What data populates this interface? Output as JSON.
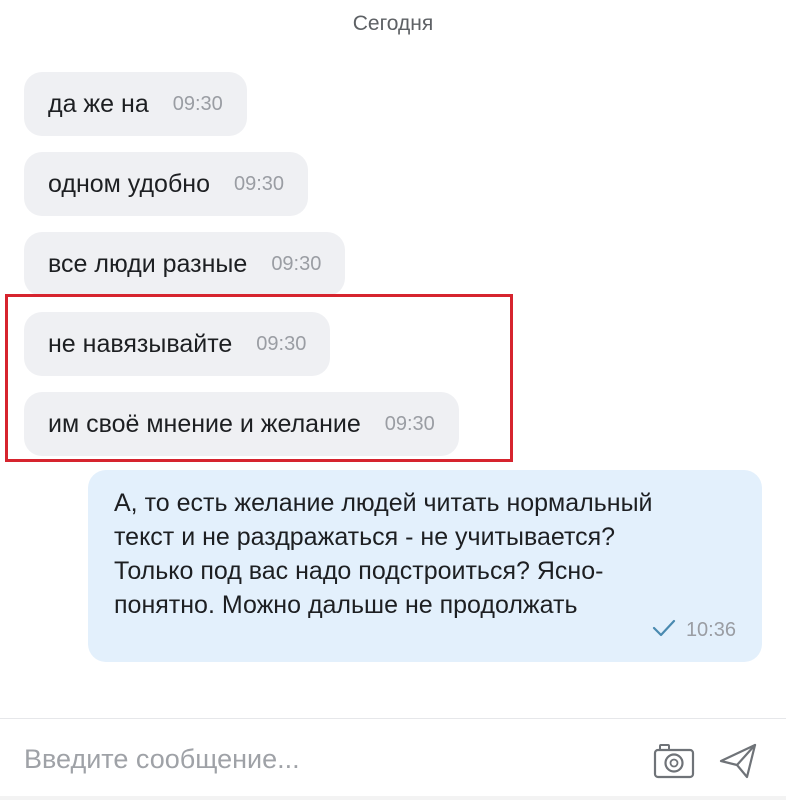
{
  "date_separator": "Сегодня",
  "incoming_messages": [
    {
      "text": "да же на",
      "time": "09:30"
    },
    {
      "text": "одном удобно",
      "time": "09:30"
    },
    {
      "text": "все люди разные",
      "time": "09:30"
    },
    {
      "text": "не навязывайте",
      "time": "09:30"
    },
    {
      "text": "им своё мнение и желание",
      "time": "09:30"
    }
  ],
  "highlight_color": "#d6242e",
  "outgoing_message": {
    "lines": [
      "А, то есть желание людей читать нормальный",
      "текст и не раздражаться - не учитывается?",
      "Только под вас надо подстроиться? Ясно-",
      "понятно. Можно дальше не продолжать"
    ],
    "time": "10:36",
    "status_icon": "check-icon"
  },
  "composer": {
    "placeholder": "Введите сообщение...",
    "camera_icon": "camera-icon",
    "send_icon": "send-icon"
  },
  "colors": {
    "incoming_bubble": "#eff0f3",
    "outgoing_bubble": "#e3f0fc",
    "check_mark": "#4a8ab0"
  }
}
